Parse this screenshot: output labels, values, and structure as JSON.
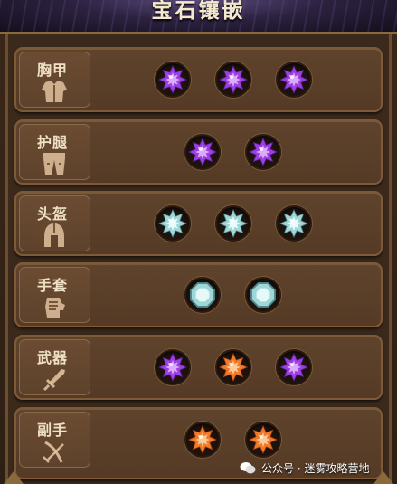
{
  "header": {
    "title": "宝石镶嵌"
  },
  "rows": [
    {
      "label": "胸甲",
      "icon": "chest-armor-icon",
      "gems": [
        "amethyst",
        "amethyst",
        "amethyst"
      ]
    },
    {
      "label": "护腿",
      "icon": "leg-armor-icon",
      "gems": [
        "amethyst",
        "amethyst"
      ]
    },
    {
      "label": "头盔",
      "icon": "helmet-icon",
      "gems": [
        "diamond-star",
        "diamond-star",
        "diamond-star"
      ]
    },
    {
      "label": "手套",
      "icon": "gauntlet-icon",
      "gems": [
        "diamond-octagon",
        "diamond-octagon"
      ]
    },
    {
      "label": "武器",
      "icon": "sword-icon",
      "gems": [
        "amethyst",
        "topaz",
        "amethyst"
      ]
    },
    {
      "label": "副手",
      "icon": "offhand-icon",
      "gems": [
        "topaz",
        "topaz"
      ]
    }
  ],
  "watermark": {
    "text": "公众号 · 迷雾攻略营地",
    "icon": "wechat-icon"
  },
  "colors": {
    "amethyst": "#9b3fe0",
    "topaz": "#f07a2a",
    "diamond": "#9fd6d8",
    "label_text": "#efe1c6"
  }
}
